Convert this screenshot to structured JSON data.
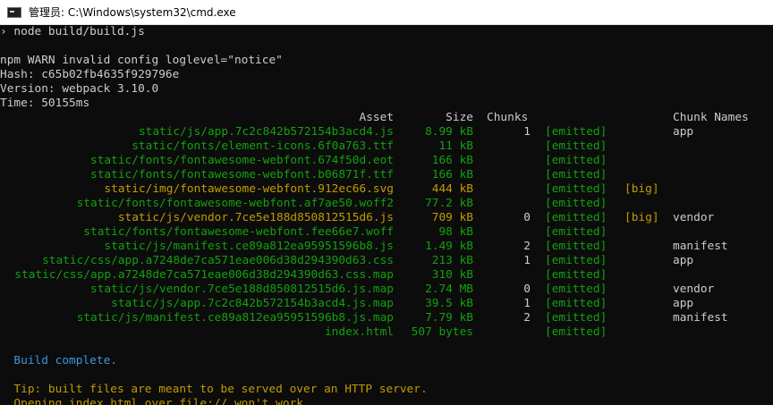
{
  "window": {
    "title": "管理员: C:\\Windows\\system32\\cmd.exe"
  },
  "console": {
    "command_line": "› node build/build.js",
    "npm_warn": "npm WARN invalid config loglevel=\"notice\"",
    "hash": "Hash: c65b02fb4635f929796e",
    "version": "Version: webpack 3.10.0",
    "time": "Time: 50155ms",
    "headers": {
      "asset": "Asset",
      "size": "Size",
      "chunks": "Chunks",
      "chunk_names": "Chunk Names"
    },
    "rows": [
      {
        "asset": "static/js/app.7c2c842b572154b3acd4.js",
        "size": "8.99 kB",
        "chunks": "1",
        "emitted": "[emitted]",
        "big": "",
        "names": "app",
        "color": "green"
      },
      {
        "asset": "static/fonts/element-icons.6f0a763.ttf",
        "size": "11 kB",
        "chunks": "",
        "emitted": "[emitted]",
        "big": "",
        "names": "",
        "color": "green"
      },
      {
        "asset": "static/fonts/fontawesome-webfont.674f50d.eot",
        "size": "166 kB",
        "chunks": "",
        "emitted": "[emitted]",
        "big": "",
        "names": "",
        "color": "green"
      },
      {
        "asset": "static/fonts/fontawesome-webfont.b06871f.ttf",
        "size": "166 kB",
        "chunks": "",
        "emitted": "[emitted]",
        "big": "",
        "names": "",
        "color": "green"
      },
      {
        "asset": "static/img/fontawesome-webfont.912ec66.svg",
        "size": "444 kB",
        "chunks": "",
        "emitted": "[emitted]",
        "big": "[big]",
        "names": "",
        "color": "yellow"
      },
      {
        "asset": "static/fonts/fontawesome-webfont.af7ae50.woff2",
        "size": "77.2 kB",
        "chunks": "",
        "emitted": "[emitted]",
        "big": "",
        "names": "",
        "color": "green"
      },
      {
        "asset": "static/js/vendor.7ce5e188d850812515d6.js",
        "size": "709 kB",
        "chunks": "0",
        "emitted": "[emitted]",
        "big": "[big]",
        "names": "vendor",
        "color": "yellow"
      },
      {
        "asset": "static/fonts/fontawesome-webfont.fee66e7.woff",
        "size": "98 kB",
        "chunks": "",
        "emitted": "[emitted]",
        "big": "",
        "names": "",
        "color": "green"
      },
      {
        "asset": "static/js/manifest.ce89a812ea95951596b8.js",
        "size": "1.49 kB",
        "chunks": "2",
        "emitted": "[emitted]",
        "big": "",
        "names": "manifest",
        "color": "green"
      },
      {
        "asset": "static/css/app.a7248de7ca571eae006d38d294390d63.css",
        "size": "213 kB",
        "chunks": "1",
        "emitted": "[emitted]",
        "big": "",
        "names": "app",
        "color": "green"
      },
      {
        "asset": "static/css/app.a7248de7ca571eae006d38d294390d63.css.map",
        "size": "310 kB",
        "chunks": "",
        "emitted": "[emitted]",
        "big": "",
        "names": "",
        "color": "green"
      },
      {
        "asset": "static/js/vendor.7ce5e188d850812515d6.js.map",
        "size": "2.74 MB",
        "chunks": "0",
        "emitted": "[emitted]",
        "big": "",
        "names": "vendor",
        "color": "green"
      },
      {
        "asset": "static/js/app.7c2c842b572154b3acd4.js.map",
        "size": "39.5 kB",
        "chunks": "1",
        "emitted": "[emitted]",
        "big": "",
        "names": "app",
        "color": "green"
      },
      {
        "asset": "static/js/manifest.ce89a812ea95951596b8.js.map",
        "size": "7.79 kB",
        "chunks": "2",
        "emitted": "[emitted]",
        "big": "",
        "names": "manifest",
        "color": "green"
      },
      {
        "asset": "index.html",
        "size": "507 bytes",
        "chunks": "",
        "emitted": "[emitted]",
        "big": "",
        "names": "",
        "color": "green"
      }
    ],
    "build_complete": "  Build complete.",
    "tip": "  Tip: built files are meant to be served over an HTTP server.",
    "opening_partial": "  Opening index.html over file:// won't work."
  },
  "colors": {
    "background": "#0c0c0c",
    "default_text": "#cccccc",
    "green": "#13a10e",
    "yellow": "#c19c00",
    "blue": "#3a96dd"
  }
}
